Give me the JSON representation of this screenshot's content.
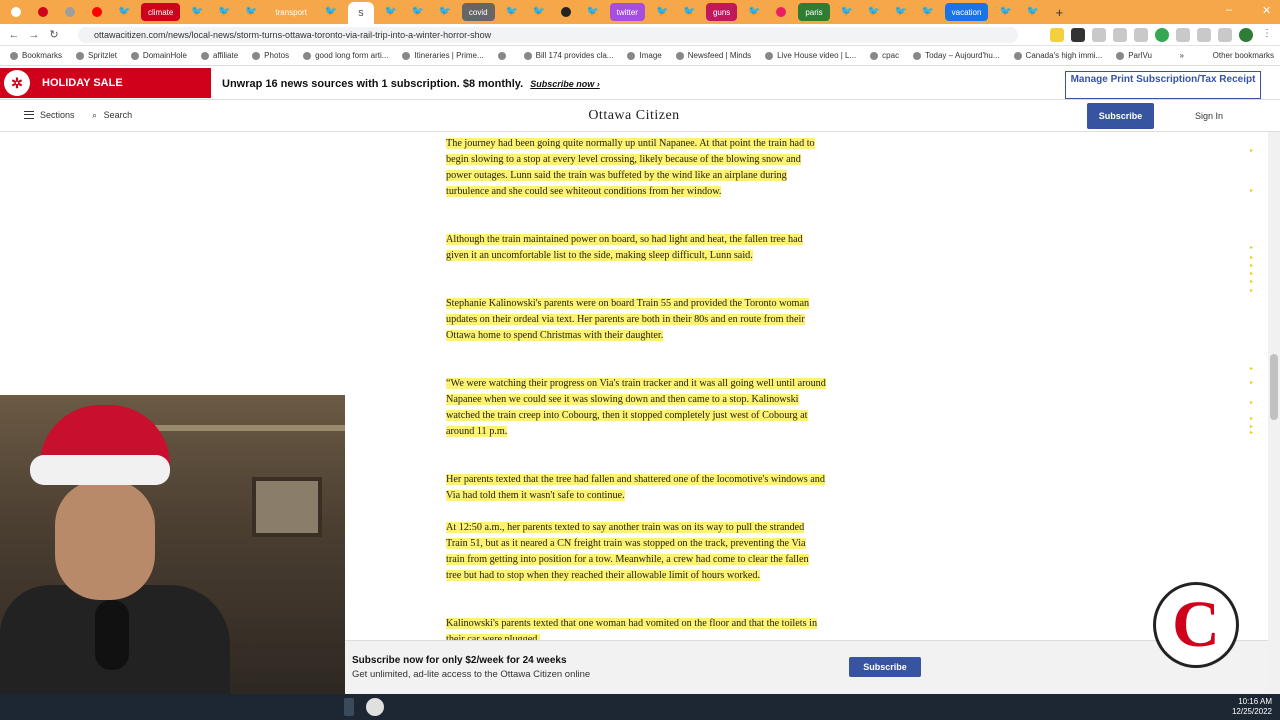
{
  "browser": {
    "tabs": [
      {
        "type": "icon",
        "color": "#ffffff"
      },
      {
        "type": "icon",
        "color": "#d0021b"
      },
      {
        "type": "icon",
        "color": "#9e9e9e"
      },
      {
        "type": "icon",
        "color": "#ff0000"
      },
      {
        "type": "twitter"
      },
      {
        "type": "label",
        "label": "climate",
        "color": "#d0021b"
      },
      {
        "type": "twitter"
      },
      {
        "type": "twitter"
      },
      {
        "type": "twitter"
      },
      {
        "type": "label",
        "label": "transport",
        "color": "#f6a74a"
      },
      {
        "type": "twitter"
      },
      {
        "type": "active",
        "label": "S"
      },
      {
        "type": "twitter"
      },
      {
        "type": "twitter"
      },
      {
        "type": "twitter"
      },
      {
        "type": "label",
        "label": "covid",
        "color": "#666666"
      },
      {
        "type": "twitter"
      },
      {
        "type": "twitter"
      },
      {
        "type": "icon",
        "color": "#222222"
      },
      {
        "type": "twitter"
      },
      {
        "type": "label",
        "label": "twitter",
        "color": "#a64ee0"
      },
      {
        "type": "twitter"
      },
      {
        "type": "twitter"
      },
      {
        "type": "label",
        "label": "guns",
        "color": "#c2185b"
      },
      {
        "type": "twitter"
      },
      {
        "type": "icon",
        "color": "#e91e63"
      },
      {
        "type": "label",
        "label": "paris",
        "color": "#2e7d32"
      },
      {
        "type": "twitter"
      },
      {
        "type": "twitter"
      },
      {
        "type": "twitter"
      },
      {
        "type": "twitter"
      },
      {
        "type": "label",
        "label": "vacation",
        "color": "#1a73e8"
      },
      {
        "type": "twitter"
      },
      {
        "type": "twitter"
      }
    ],
    "new_tab": "+",
    "url": "ottawacitizen.com/news/local-news/storm-turns-ottawa-toronto-via-rail-trip-into-a-winter-horror-show",
    "bookmarks": [
      "Bookmarks",
      "Spritzlet",
      "DomainHole",
      "affiliate",
      "Photos",
      "good long form arti...",
      "Itineraries | Prime...",
      "",
      "Bill 174 provides cla...",
      "Image",
      "Newsfeed | Minds",
      "Live House video | L...",
      "cpac",
      "Today – Aujourd'hu...",
      "Canada's high immi...",
      "ParlVu"
    ],
    "bookmarks_more": "»",
    "other_bookmarks": "Other bookmarks"
  },
  "promo": {
    "holiday_sale": "HOLIDAY SALE",
    "text": "Unwrap 16 news sources with 1 subscription. $8 monthly.",
    "link": "Subscribe now ›",
    "manage": "Manage Print Subscription/Tax Receipt"
  },
  "header": {
    "sections": "Sections",
    "search": "Search",
    "masthead": "Ottawa Citizen",
    "subscribe": "Subscribe",
    "sign_in": "Sign In"
  },
  "article": {
    "paragraphs": [
      "The journey had been going quite normally up until Napanee. At that point the train had to begin slowing to a stop at every level crossing, likely because of the blowing snow and power outages. Lunn said the train was buffeted by the wind like an airplane during turbulence and she could see whiteout conditions from her window.",
      "Although the train maintained power on board, so had light and heat, the fallen tree had given it an uncomfortable list to the side, making sleep difficult, Lunn said.",
      "Stephanie Kalinowski's parents were on board Train 55 and provided the Toronto woman updates on their ordeal via text. Her parents are both in their 80s and en route from their Ottawa home to spend Christmas with their daughter.",
      "“We were watching their progress on Via's train tracker and it was all going well until around Napanee when we could see it was slowing down and then came to a stop. Kalinowski watched the train creep into Cobourg, then it stopped completely just west of Cobourg at around 11 p.m.",
      "Her parents texted that the tree had fallen and shattered one of the locomotive's windows and Via had told them it wasn't safe to continue.",
      "At 12:50 a.m., her parents texted to say another train was on its way to pull the stranded Train 51, but as it neared a CN freight train was stopped on the track, preventing the Via train from getting into position for a tow. Meanwhile, a crew had come to clear the fallen tree but had to stop when they reached their allowable limit of hours worked.",
      "Kalinowski's parents texted that one woman had vomited on the floor and that the toilets in their car were plugged."
    ]
  },
  "subscribe_bar": {
    "title": "Subscribe now for only $2/week for 24 weeks",
    "desc": "Get unlimited, ad-lite access to the Ottawa Citizen online",
    "button": "Subscribe"
  },
  "badge": "C",
  "taskbar": {
    "time": "10:16 AM",
    "date": "12/25/2022"
  },
  "colors": {
    "brand_red": "#d0021b",
    "brand_blue": "#3754a1",
    "highlight": "#fff176",
    "tab_strip": "#f6a74a"
  }
}
